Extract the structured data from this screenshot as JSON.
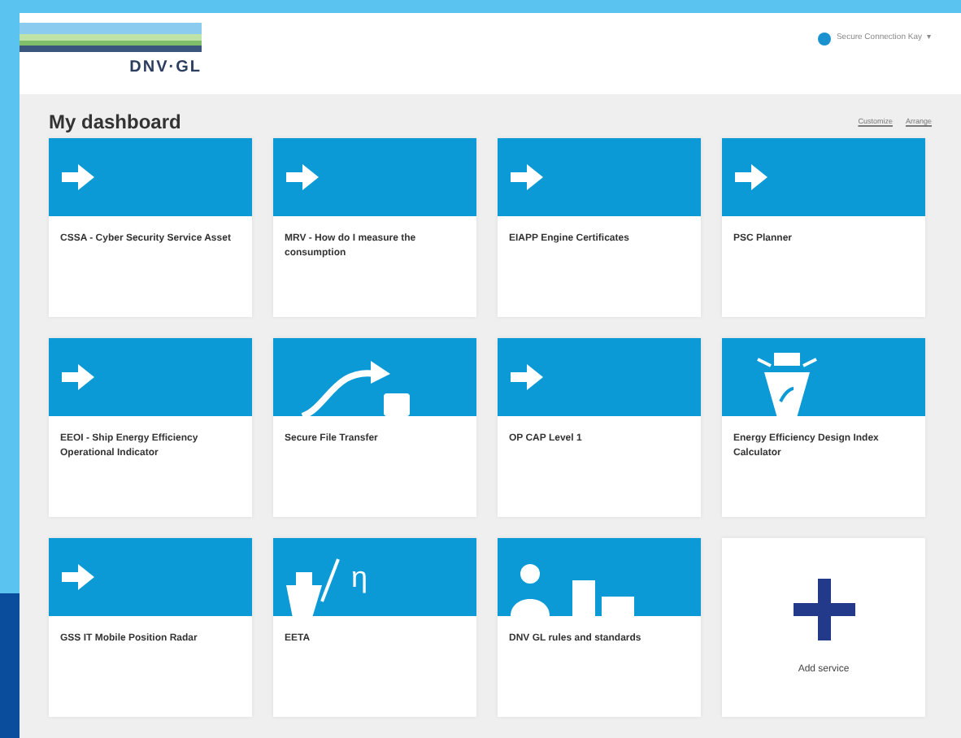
{
  "header": {
    "logo": "DNV·GL",
    "user": "Secure Connection Kay",
    "caret": "▾"
  },
  "dashboard": {
    "title": "My dashboard",
    "links": [
      "Customize",
      "Arrange"
    ]
  },
  "tiles": [
    {
      "kind": "arrow",
      "label": "CSSA - Cyber Security Service Asset"
    },
    {
      "kind": "arrow",
      "label": "MRV - How do I measure the consumption"
    },
    {
      "kind": "arrow",
      "label": "EIAPP Engine Certificates"
    },
    {
      "kind": "arrow",
      "label": "PSC Planner"
    },
    {
      "kind": "arrow",
      "label": "EEOI - Ship Energy Efficiency Operational Indicator"
    },
    {
      "kind": "transfer",
      "label": "Secure File Transfer"
    },
    {
      "kind": "arrow",
      "label": "OP CAP Level 1"
    },
    {
      "kind": "ship",
      "label": "Energy Efficiency Design Index Calculator"
    },
    {
      "kind": "arrow",
      "label": "GSS IT Mobile Position Radar"
    },
    {
      "kind": "eta",
      "label": "EETA",
      "symbol": "η"
    },
    {
      "kind": "rules",
      "label": "DNV GL rules and standards"
    },
    {
      "kind": "add",
      "label": "Add service"
    }
  ]
}
